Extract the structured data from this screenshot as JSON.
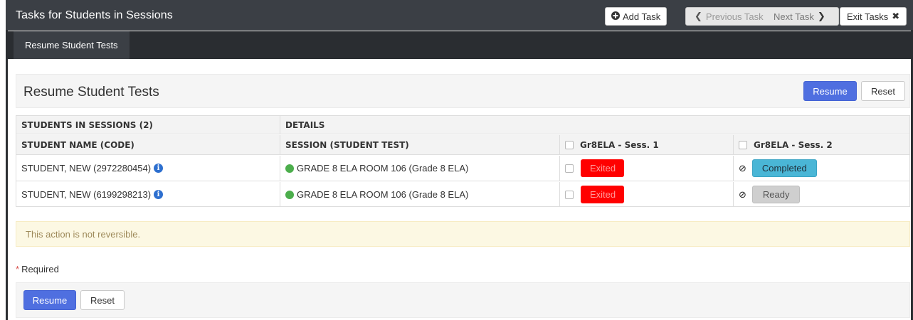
{
  "header": {
    "title": "Tasks for Students in Sessions",
    "add_task": "Add Task",
    "previous_task": "Previous Task",
    "next_task": "Next Task",
    "exit_tasks": "Exit Tasks"
  },
  "tabs": [
    {
      "label": "Resume Student Tests"
    }
  ],
  "panel": {
    "title": "Resume Student Tests",
    "resume": "Resume",
    "reset": "Reset"
  },
  "table": {
    "group_headers": [
      "STUDENTS IN SESSIONS (2)",
      "DETAILS"
    ],
    "columns": [
      "STUDENT NAME (CODE)",
      "SESSION (STUDENT TEST)",
      "Gr8ELA - Sess. 1",
      "Gr8ELA - Sess. 2"
    ],
    "rows": [
      {
        "student": "STUDENT, NEW (2972280454)",
        "session": "GRADE 8 ELA ROOM 106 (Grade 8 ELA)",
        "sess1": "Exited",
        "sess2": "Completed"
      },
      {
        "student": "STUDENT, NEW (6199298213)",
        "session": "GRADE 8 ELA ROOM 106 (Grade 8 ELA)",
        "sess1": "Exited",
        "sess2": "Ready"
      }
    ]
  },
  "warning": "This action is not reversible.",
  "required_label": "Required",
  "footer": {
    "resume": "Resume",
    "reset": "Reset"
  },
  "colors": {
    "primary_button": "#4f6fe0",
    "exited_status": "#ff0000",
    "completed_status": "#4ab6d6",
    "ready_status": "#cfcfcf",
    "session_active_dot": "#4cae4c",
    "topbar": "#3b3f45"
  },
  "icons": {
    "add_task": "plus-circle-icon",
    "previous": "chevron-left-icon",
    "next": "chevron-right-icon",
    "exit": "close-icon",
    "info": "info-circle-icon",
    "no_entry": "ban-icon"
  }
}
